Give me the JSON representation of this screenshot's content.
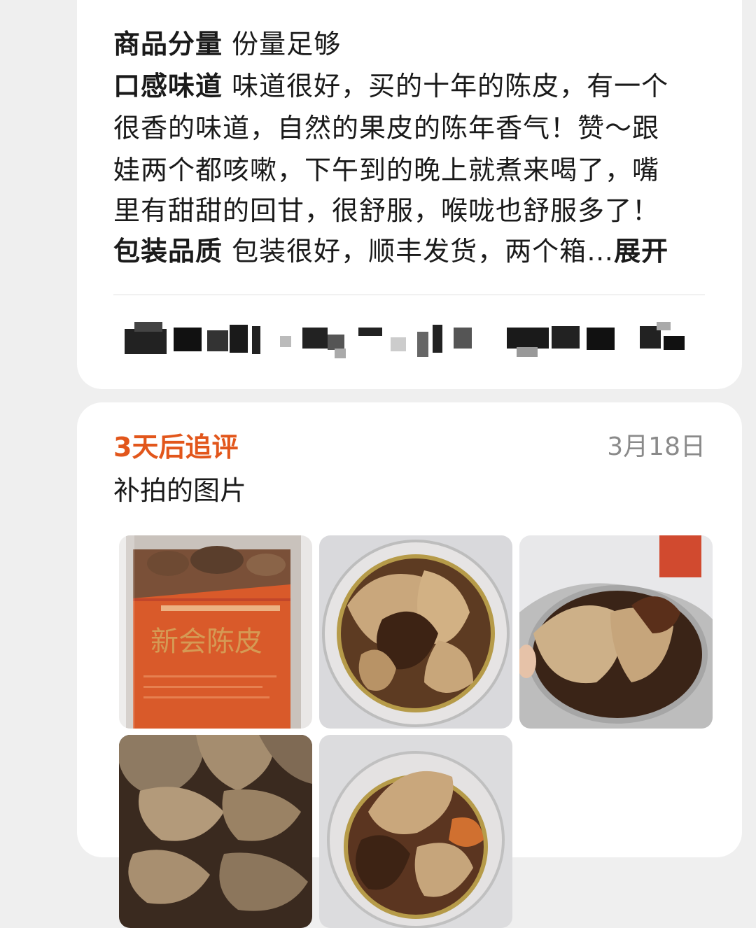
{
  "review": {
    "rows": [
      {
        "tag": "商品分量",
        "text": "份量足够"
      },
      {
        "tag": "口感味道",
        "text": "味道很好，买的十年的陈皮，有一个"
      },
      {
        "tag": "",
        "text": "很香的味道，自然的果皮的陈年香气！赞～跟"
      },
      {
        "tag": "",
        "text": "娃两个都咳嗽，下午到的晚上就煮来喝了，嘴"
      },
      {
        "tag": "",
        "text": "里有甜甜的回甘，很舒服，喉咙也舒服多了！"
      },
      {
        "tag": "包装品质",
        "text": "包装很好，顺丰发货，两个箱…"
      }
    ],
    "expand_label": "展开"
  },
  "followup": {
    "title": "3天后追评",
    "date": "3月18日",
    "text": "补拍的图片",
    "photos": [
      {
        "name": "photo-jar-label",
        "label_text": "新会陈皮"
      },
      {
        "name": "photo-jar-top-1"
      },
      {
        "name": "photo-held-peel"
      },
      {
        "name": "photo-peel-closeup"
      },
      {
        "name": "photo-jar-top-2"
      }
    ]
  },
  "colors": {
    "accent": "#e2561b",
    "date": "#8a8a8a",
    "card": "#ffffff",
    "background": "#efefef"
  }
}
